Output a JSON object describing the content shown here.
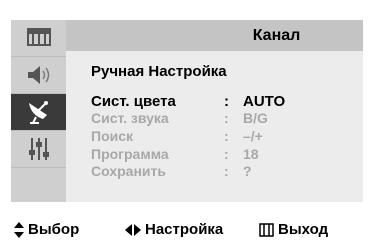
{
  "menu": {
    "header_title": "Канал",
    "subtitle": "Ручная Настройка",
    "sidebar": [
      {
        "icon": "picture-icon"
      },
      {
        "icon": "speaker-icon"
      },
      {
        "icon": "satellite-antenna-icon",
        "selected": true
      },
      {
        "icon": "settings-sliders-icon"
      },
      {
        "icon": "empty"
      }
    ],
    "rows": [
      {
        "label": "Сист. цвета",
        "colon": ":",
        "value": "AUTO",
        "active": true
      },
      {
        "label": "Сист. звука",
        "colon": ":",
        "value": "B/G",
        "active": false
      },
      {
        "label": "Поиск",
        "colon": ":",
        "value": "–/+",
        "active": false
      },
      {
        "label": "Программа",
        "colon": ":",
        "value": "18",
        "active": false
      },
      {
        "label": "Сохранить",
        "colon": ":",
        "value": "?",
        "active": false
      }
    ]
  },
  "footer": {
    "select_label": "Выбор",
    "adjust_label": "Настройка",
    "exit_label": "Выход"
  },
  "colors": {
    "selected_icon_bg": "#3a3a3a",
    "header_bg": "#c4c4c4",
    "panel_bg": "#ececec",
    "dim_text": "#a8a8a8"
  }
}
